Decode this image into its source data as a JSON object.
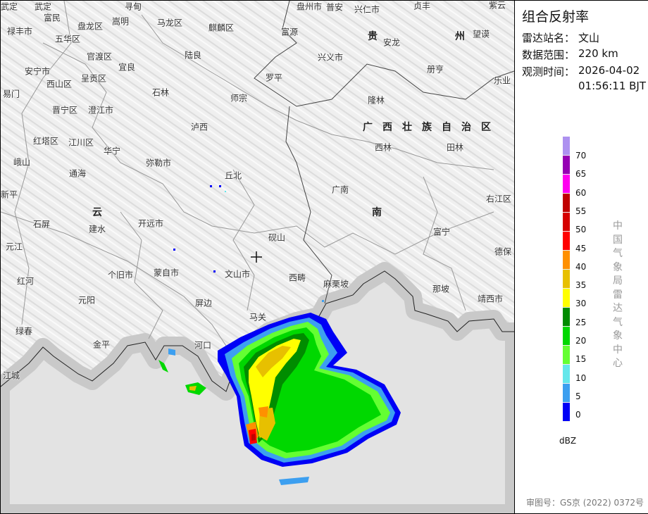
{
  "panel": {
    "title": "组合反射率",
    "station_label": "雷达站名：",
    "station_value": "文山",
    "range_label": "数据范围：",
    "range_value": "220 km",
    "time_label": "观测时间：",
    "time_date": "2026-04-02",
    "time_clock": "01:56:11 BJT",
    "legend_unit": "dBZ",
    "source_text": "中国气象局雷达气象中心",
    "footer": "审图号：GS京 (2022) 0372号"
  },
  "legend": {
    "colors": [
      "#ad91f0",
      "#9600b4",
      "#ff00f0",
      "#c00000",
      "#d60000",
      "#ff0000",
      "#ff9000",
      "#e7c000",
      "#ffff00",
      "#008c00",
      "#00d800",
      "#64ff32",
      "#64e7eb",
      "#3c9ff0",
      "#0000f6"
    ],
    "ticks": [
      "70",
      "65",
      "60",
      "55",
      "50",
      "45",
      "40",
      "35",
      "30",
      "25",
      "20",
      "15",
      "10",
      "5",
      "0"
    ]
  },
  "map": {
    "radar_site_icon": "crosshair-icon",
    "provinces": [
      "云",
      "贵",
      "州",
      "广西壮族自治区",
      "南"
    ],
    "places": [
      "武定",
      "武定",
      "寻甸",
      "富民",
      "嵩明",
      "马龙区",
      "盘龙区",
      "麒麟区",
      "禄丰市",
      "五华区",
      "富源",
      "盘州市",
      "普安",
      "兴仁市",
      "贞丰",
      "紫云",
      "安龙",
      "望谟",
      "官渡区",
      "陆良",
      "兴义市",
      "宜良",
      "安宁市",
      "呈贡区",
      "西山区",
      "罗平",
      "册亨",
      "乐业",
      "易门",
      "石林",
      "师宗",
      "隆林",
      "晋宁区",
      "澄江市",
      "泸西",
      "西林",
      "田林",
      "红塔区",
      "江川区",
      "华宁",
      "峨山",
      "弥勒市",
      "通海",
      "丘北",
      "广南",
      "新平",
      "石屏",
      "建水",
      "开远市",
      "右江区",
      "砚山",
      "富宁",
      "元江",
      "德保",
      "个旧市",
      "蒙自市",
      "文山市",
      "西畴",
      "麻栗坡",
      "红河",
      "那坡",
      "靖西市",
      "元阳",
      "屏边",
      "马关",
      "绿春",
      "金平",
      "河口",
      "江城"
    ]
  }
}
